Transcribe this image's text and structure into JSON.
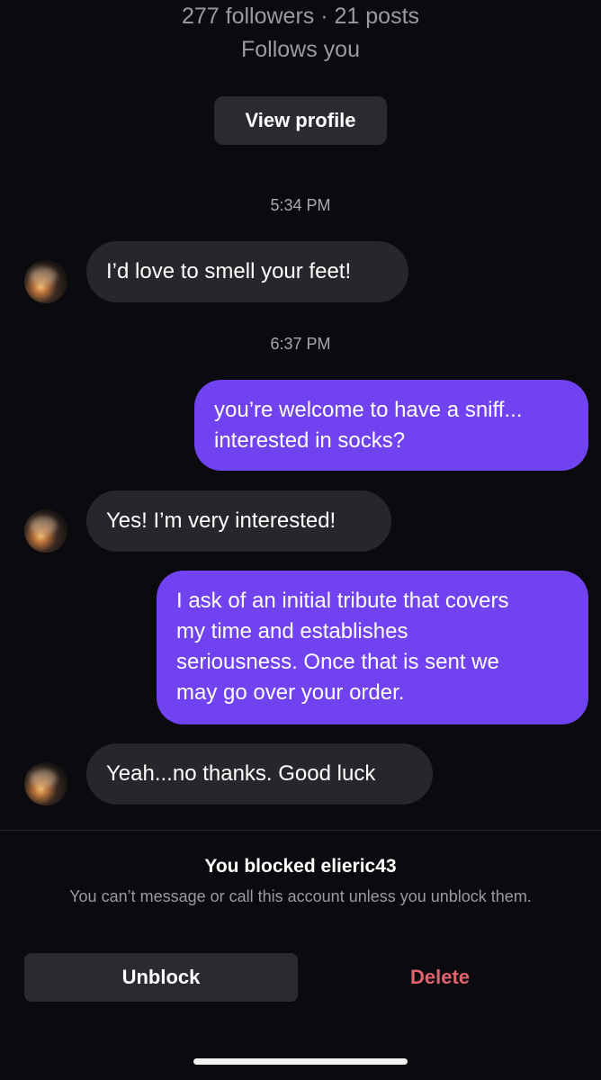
{
  "profile": {
    "stats": "277 followers · 21 posts",
    "follows_status": "Follows you",
    "view_profile_label": "View profile"
  },
  "conversation": {
    "timestamps": [
      "5:34 PM",
      "6:37 PM"
    ],
    "messages": [
      {
        "sender": "them",
        "text": "I’d love to smell your feet!"
      },
      {
        "sender": "me",
        "text": "you’re welcome to have a sniff...\ninterested in socks?"
      },
      {
        "sender": "them",
        "text": "Yes! I’m very interested!"
      },
      {
        "sender": "me",
        "text": "I ask of an initial tribute that covers\nmy time and establishes\nseriousness. Once that is sent we\nmay go over your order."
      },
      {
        "sender": "them",
        "text": "Yeah...no thanks. Good luck"
      }
    ]
  },
  "blocked_notice": {
    "title": "You blocked elieric43",
    "description": "You can’t message or call this account unless you unblock them.",
    "unblock_label": "Unblock",
    "delete_label": "Delete"
  },
  "colors": {
    "background": "#0b0b0f",
    "incoming_bubble": "#26272b",
    "outgoing_bubble": "#7042f0",
    "delete_text": "#e0636e"
  }
}
